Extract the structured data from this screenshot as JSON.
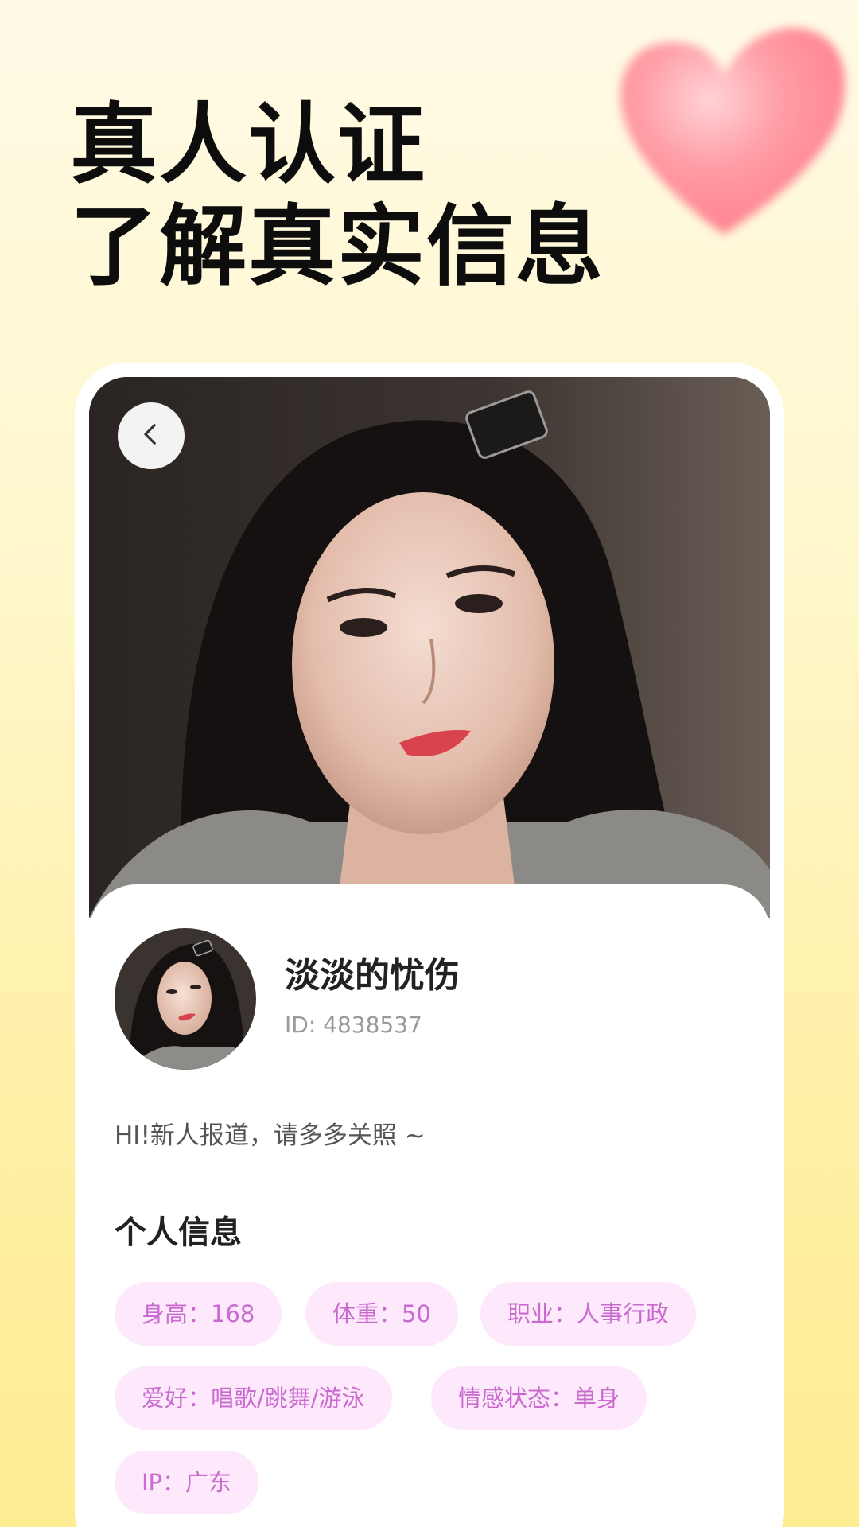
{
  "headline": {
    "line1": "真人认证",
    "line2": "了解真实信息"
  },
  "profile": {
    "name": "淡淡的忧伤",
    "id": "ID: 4838537",
    "bio": "HI!新人报道，请多多关照 ~",
    "section_title": "个人信息",
    "tags": [
      "身高：168",
      "体重：50",
      "职业：人事行政",
      "爱好：唱歌/跳舞/游泳",
      "情感状态：单身",
      "IP：广东"
    ]
  },
  "icons": {
    "back": "chevron-left-icon",
    "decoration": "heart-icon"
  },
  "colors": {
    "tag_bg": "#fde9fb",
    "tag_text": "#c96ad0",
    "background_top": "#fffbe6",
    "background_bottom": "#ffed93"
  }
}
